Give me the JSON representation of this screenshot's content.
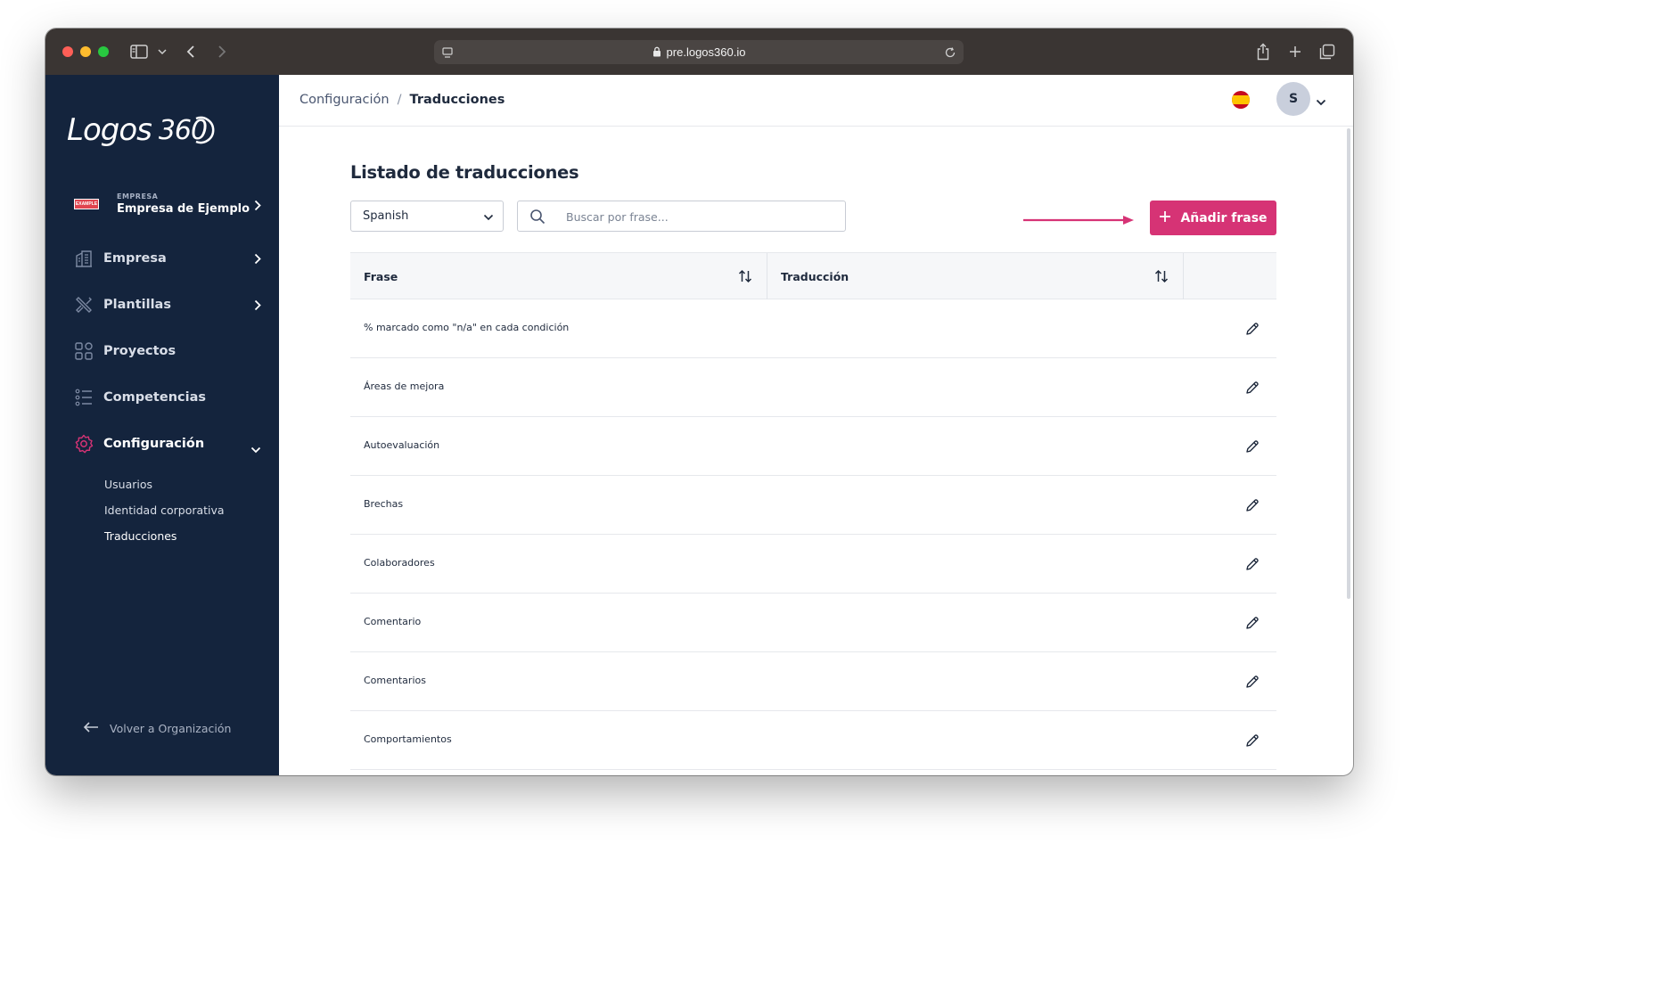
{
  "browser": {
    "url": "pre.logos360.io"
  },
  "sidebar": {
    "logo_word": "Logos",
    "logo_number": "360",
    "company": {
      "badge": "EXAMPLE",
      "caption": "EMPRESA",
      "name": "Empresa de Ejemplo"
    },
    "items": [
      {
        "label": "Empresa",
        "icon": "building-icon"
      },
      {
        "label": "Plantillas",
        "icon": "tools-icon"
      },
      {
        "label": "Proyectos",
        "icon": "grid-icon"
      },
      {
        "label": "Competencias",
        "icon": "list-icon"
      },
      {
        "label": "Configuración",
        "icon": "gear-icon"
      }
    ],
    "sub_items": [
      {
        "label": "Usuarios"
      },
      {
        "label": "Identidad corporativa"
      },
      {
        "label": "Traducciones"
      }
    ],
    "back_label": "Volver a Organización"
  },
  "header": {
    "breadcrumb": [
      "Configuración",
      "Traducciones"
    ],
    "avatar_initial": "S"
  },
  "main": {
    "title": "Listado de traducciones",
    "language_select": "Spanish",
    "search_placeholder": "Buscar por frase...",
    "add_button": "Añadir frase",
    "columns": [
      "Frase",
      "Traducción"
    ],
    "rows": [
      {
        "frase": "% marcado como \"n/a\" en cada condición",
        "traduccion": ""
      },
      {
        "frase": "Áreas de mejora",
        "traduccion": ""
      },
      {
        "frase": "Autoevaluación",
        "traduccion": ""
      },
      {
        "frase": "Brechas",
        "traduccion": ""
      },
      {
        "frase": "Colaboradores",
        "traduccion": ""
      },
      {
        "frase": "Comentario",
        "traduccion": ""
      },
      {
        "frase": "Comentarios",
        "traduccion": ""
      },
      {
        "frase": "Comportamientos",
        "traduccion": ""
      }
    ]
  },
  "colors": {
    "sidebar_bg": "#14243d",
    "accent": "#d63375",
    "text_dark": "#1f2a3d"
  }
}
